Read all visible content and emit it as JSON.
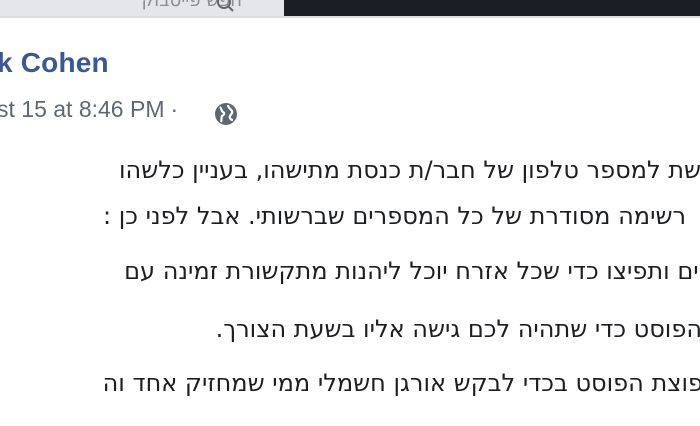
{
  "topbar": {
    "search_placeholder": "חפש פייסבוק"
  },
  "post": {
    "author": "k Cohen",
    "timestamp": "st 15 at 8:46 PM",
    "separator": "·",
    "privacy_icon": "globe-icon",
    "lines": [
      "שת למספר טלפון של חבר/ת כנסת מתישהו, בעניין כלשהו",
      "רשימה מסודרת של כל המספרים שברשותי. אבל לפני כן :",
      "יים ותפיצו כדי שכל אזרח יוכל ליהנות מתקשורת זמינה עם",
      "הפוסט כדי שתהיה לכם גישה אליו בשעת הצורך.",
      "פוצת הפוסט בכדי לבקש אורגן חשמלי ממי שמחזיק אחד וה"
    ]
  },
  "colors": {
    "author": "#385898",
    "meta": "#606770",
    "body_text": "#1c1e21",
    "topbar_dark": "#1c1e26"
  }
}
